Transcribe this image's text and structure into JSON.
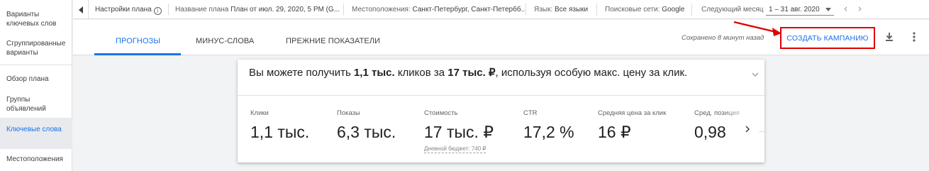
{
  "sidebar": {
    "items": [
      {
        "label": "Варианты ключевых слов"
      },
      {
        "label": "Сгруппированные варианты"
      },
      {
        "label": "Обзор плана"
      },
      {
        "label": "Группы объявлений"
      },
      {
        "label": "Ключевые слова"
      },
      {
        "label": "Местоположения"
      }
    ],
    "active_index": 4
  },
  "topbar": {
    "settings_label": "Настройки плана",
    "plan_name_label": "Название плана",
    "plan_name_value": "План от июл. 29, 2020, 5 PM (G...",
    "locations_label": "Местоположения:",
    "locations_value": "Санкт-Петербург, Санкт-Петербб...",
    "language_label": "Язык:",
    "language_value": "Все языки",
    "networks_label": "Поисковые сети:",
    "networks_value": "Google",
    "period_label": "Следующий месяц",
    "period_value": "1 – 31 авг. 2020"
  },
  "tabs": [
    {
      "label": "ПРОГНОЗЫ"
    },
    {
      "label": "МИНУС-СЛОВА"
    },
    {
      "label": "ПРЕЖНИЕ ПОКАЗАТЕЛИ"
    }
  ],
  "active_tab": 0,
  "saved_status": "Сохранено 8 минут назад",
  "create_campaign_label": "СОЗДАТЬ КАМПАНИЮ",
  "summary": {
    "prefix": "Вы можете получить ",
    "clicks": "1,1 тыс.",
    "middle": " кликов за ",
    "cost": "17 тыс. ₽",
    "suffix": ", используя особую макс. цену за клик."
  },
  "metrics": [
    {
      "label": "Клики",
      "value": "1,1 тыс."
    },
    {
      "label": "Показы",
      "value": "6,3 тыс."
    },
    {
      "label": "Стоимость",
      "value": "17 тыс. ₽",
      "sub": "Дневной бюджет: 740 ₽"
    },
    {
      "label": "CTR",
      "value": "17,2 %"
    },
    {
      "label": "Средняя цена за клик",
      "value": "16 ₽"
    },
    {
      "label": "Сред. позиция",
      "value": "0,98"
    }
  ],
  "colors": {
    "accent": "#1a73e8",
    "highlight_red": "#e00000"
  }
}
